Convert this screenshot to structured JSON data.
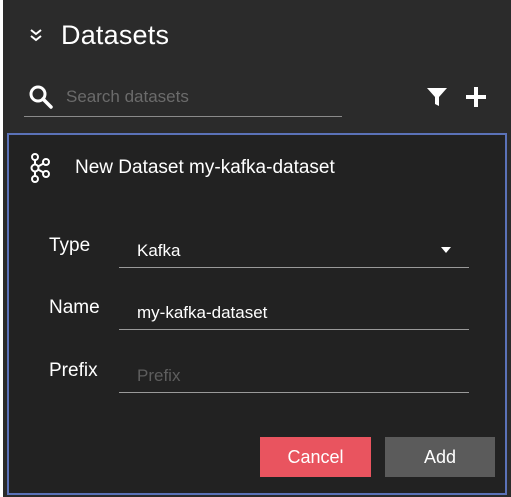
{
  "header": {
    "title": "Datasets",
    "collapse_icon": "double-chevron-down-icon"
  },
  "search": {
    "placeholder": "Search datasets",
    "value": "",
    "icons": [
      "search-icon",
      "filter-icon",
      "add-icon"
    ]
  },
  "card": {
    "icon": "kafka-icon",
    "title": "New Dataset my-kafka-dataset",
    "fields": {
      "type": {
        "label": "Type",
        "value": "Kafka"
      },
      "name": {
        "label": "Name",
        "value": "my-kafka-dataset"
      },
      "prefix": {
        "label": "Prefix",
        "value": "",
        "placeholder": "Prefix"
      }
    },
    "buttons": {
      "cancel": "Cancel",
      "add": "Add"
    }
  },
  "colors": {
    "panel_bg": "#2b2b2b",
    "card_bg": "#222222",
    "card_border": "#5b72b8",
    "cancel": "#e9545f",
    "add": "#5b5b5b"
  }
}
